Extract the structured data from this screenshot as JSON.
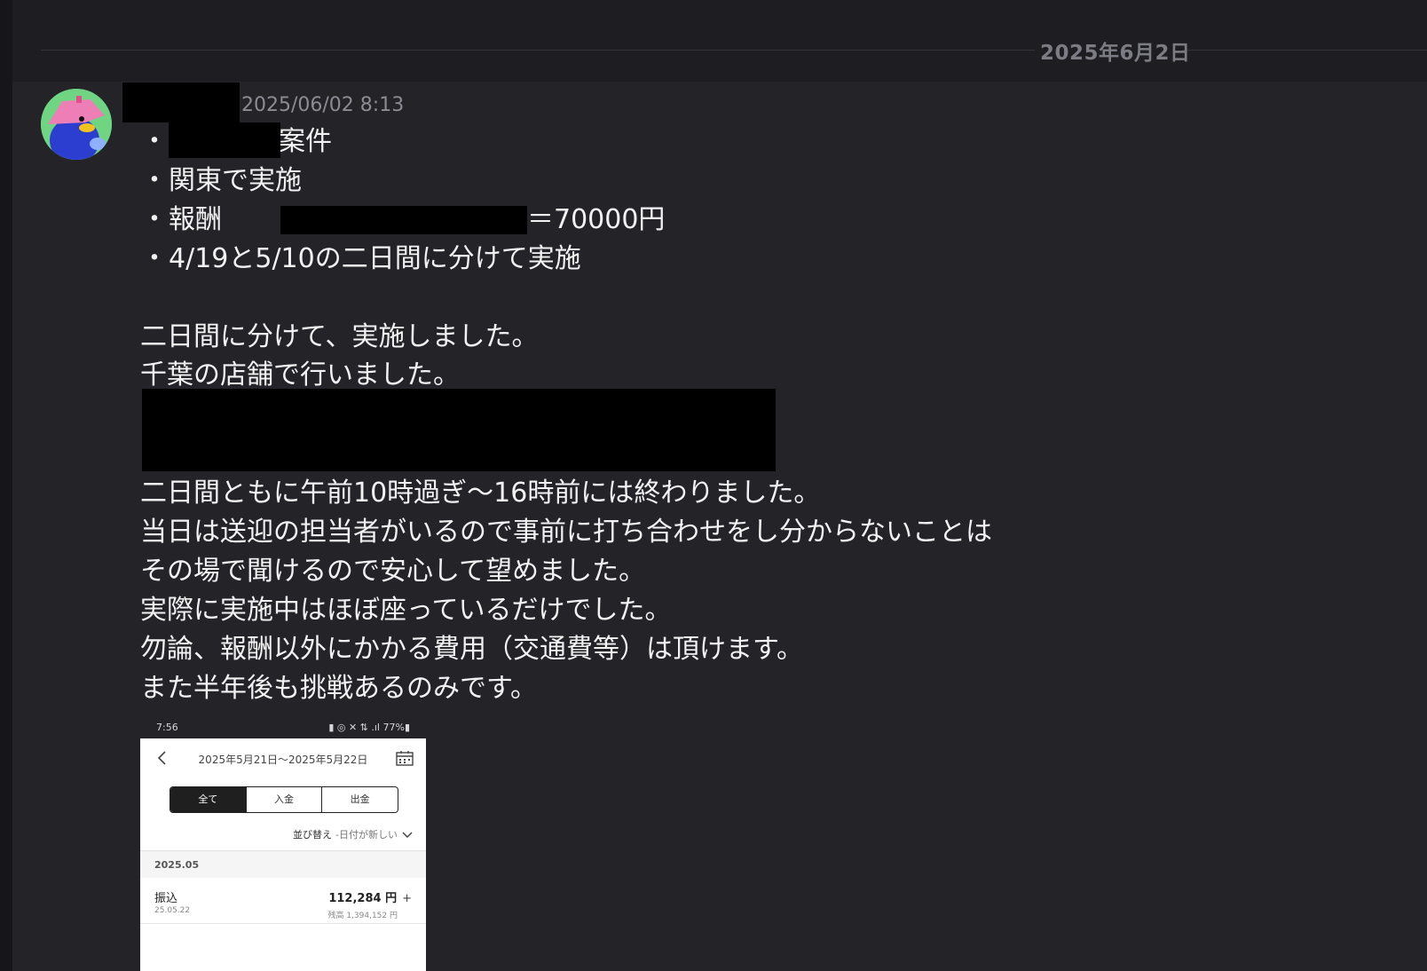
{
  "date_separator": "2025年6月2日",
  "message": {
    "timestamp": "2025/06/02 8:13",
    "bullets": [
      {
        "bullet": "・",
        "pre": "",
        "post": "案件"
      },
      {
        "bullet": "・",
        "pre": "関東で実施",
        "post": ""
      },
      {
        "bullet": "・",
        "pre": "報酬",
        "post": "＝70000円"
      },
      {
        "bullet": "・",
        "pre": "4/19と5/10の二日間に分けて実施",
        "post": ""
      }
    ],
    "paragraph1": [
      "二日間に分けて、実施しました。",
      "千葉の店舗で行いました。"
    ],
    "paragraph2": [
      "二日間ともに午前10時過ぎ〜16時前には終わりました。",
      "当日は送迎の担当者がいるので事前に打ち合わせをし分からないことは",
      "その場で聞けるので安心して望めました。",
      "実際に実施中はほぼ座っているだけでした。",
      "勿論、報酬以外にかかる費用（交通費等）は頂けます。",
      "また半年後も挑戦あるのみです。"
    ]
  },
  "attachment": {
    "status_time": "7:56",
    "status_icons": "▮ ◎ ✕ ⇅ .ıl 77%▮",
    "date_range": "2025年5月21日〜2025年5月22日",
    "tabs": [
      "全て",
      "入金",
      "出金"
    ],
    "sort_label": "並び替え",
    "sort_value": "-日付が新しい",
    "month": "2025.05",
    "transaction": {
      "type": "振込",
      "date": "25.05.22",
      "amount": "112,284 円",
      "plus": "+",
      "balance": "残高 1,394,152 円"
    }
  },
  "icons": [
    "avatar-bird-icon",
    "back-chevron-icon",
    "calendar-icon",
    "chevron-down-icon"
  ]
}
